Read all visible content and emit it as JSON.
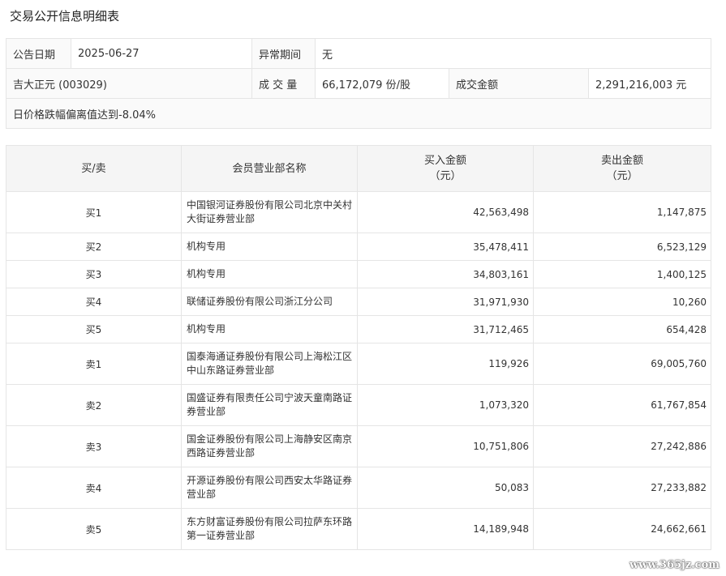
{
  "title": "交易公开信息明细表",
  "info": {
    "announce_date_label": "公告日期",
    "announce_date": "2025-06-27",
    "abnormal_period_label": "异常期间",
    "abnormal_period": "无",
    "stock": "吉大正元 (003029)",
    "volume_label": "成 交 量",
    "volume": "66,172,079 份/股",
    "amount_label": "成交金额",
    "amount": "2,291,216,003 元",
    "reason": "日价格跌幅偏离值达到-8.04%"
  },
  "detail": {
    "headers": {
      "side": "买/卖",
      "branch": "会员营业部名称",
      "buy_line1": "买入金额",
      "buy_line2": "（元）",
      "sell_line1": "卖出金额",
      "sell_line2": "（元）"
    },
    "rows": [
      {
        "side": "买1",
        "branch_line1": "中国银河证券股份有限公司北京中关村",
        "branch_line2": "大街证券营业部",
        "buy": "42,563,498",
        "sell": "1,147,875"
      },
      {
        "side": "买2",
        "branch_line1": "机构专用",
        "branch_line2": "",
        "buy": "35,478,411",
        "sell": "6,523,129"
      },
      {
        "side": "买3",
        "branch_line1": "机构专用",
        "branch_line2": "",
        "buy": "34,803,161",
        "sell": "1,400,125"
      },
      {
        "side": "买4",
        "branch_line1": "联储证券股份有限公司浙江分公司",
        "branch_line2": "",
        "buy": "31,971,930",
        "sell": "10,260"
      },
      {
        "side": "买5",
        "branch_line1": "机构专用",
        "branch_line2": "",
        "buy": "31,712,465",
        "sell": "654,428"
      },
      {
        "side": "卖1",
        "branch_line1": "国泰海通证券股份有限公司上海松江区",
        "branch_line2": "中山东路证券营业部",
        "buy": "119,926",
        "sell": "69,005,760"
      },
      {
        "side": "卖2",
        "branch_line1": "国盛证券有限责任公司宁波天童南路证",
        "branch_line2": "券营业部",
        "buy": "1,073,320",
        "sell": "61,767,854"
      },
      {
        "side": "卖3",
        "branch_line1": "国金证券股份有限公司上海静安区南京",
        "branch_line2": "西路证券营业部",
        "buy": "10,751,806",
        "sell": "27,242,886"
      },
      {
        "side": "卖4",
        "branch_line1": "开源证券股份有限公司西安太华路证券",
        "branch_line2": "营业部",
        "buy": "50,083",
        "sell": "27,233,882"
      },
      {
        "side": "卖5",
        "branch_line1": "东方财富证券股份有限公司拉萨东环路",
        "branch_line2": "第一证券营业部",
        "buy": "14,189,948",
        "sell": "24,662,661"
      }
    ]
  },
  "watermark": "www.365jz.com"
}
